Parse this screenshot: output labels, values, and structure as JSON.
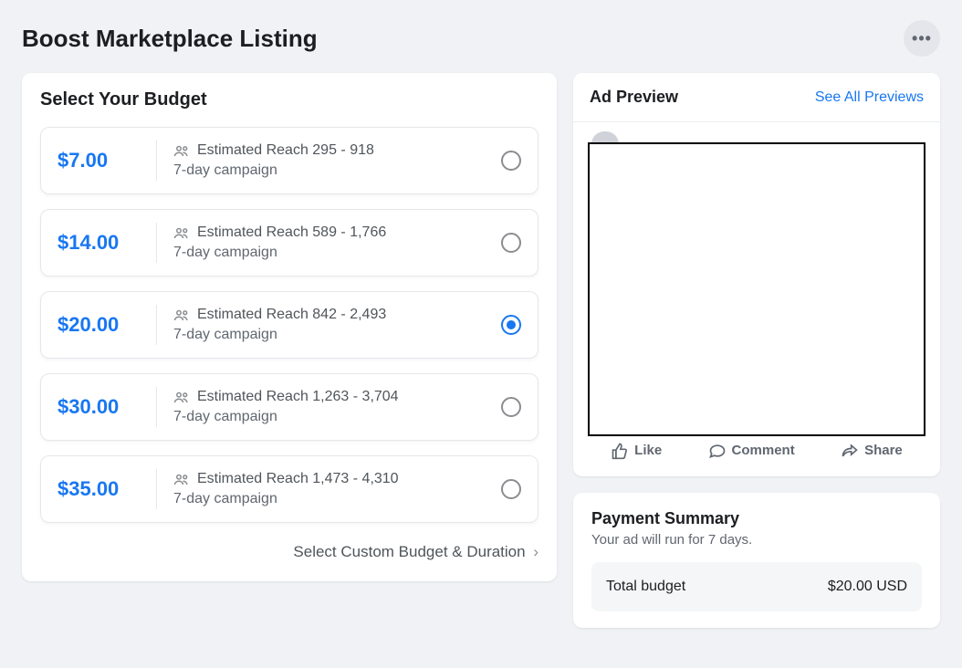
{
  "header": {
    "title": "Boost Marketplace Listing"
  },
  "budget": {
    "heading": "Select Your Budget",
    "custom_label": "Select Custom Budget & Duration",
    "options": [
      {
        "price": "$7.00",
        "reach": "Estimated Reach 295 - 918",
        "campaign": "7-day campaign",
        "selected": false
      },
      {
        "price": "$14.00",
        "reach": "Estimated Reach 589 - 1,766",
        "campaign": "7-day campaign",
        "selected": false
      },
      {
        "price": "$20.00",
        "reach": "Estimated Reach 842 - 2,493",
        "campaign": "7-day campaign",
        "selected": true
      },
      {
        "price": "$30.00",
        "reach": "Estimated Reach 1,263 - 3,704",
        "campaign": "7-day campaign",
        "selected": false
      },
      {
        "price": "$35.00",
        "reach": "Estimated Reach 1,473 - 4,310",
        "campaign": "7-day campaign",
        "selected": false
      }
    ]
  },
  "preview": {
    "heading": "Ad Preview",
    "see_all": "See All Previews",
    "actions": {
      "like": "Like",
      "comment": "Comment",
      "share": "Share"
    }
  },
  "summary": {
    "heading": "Payment Summary",
    "sub": "Your ad will run for 7 days.",
    "total_label": "Total budget",
    "total_value": "$20.00 USD"
  }
}
